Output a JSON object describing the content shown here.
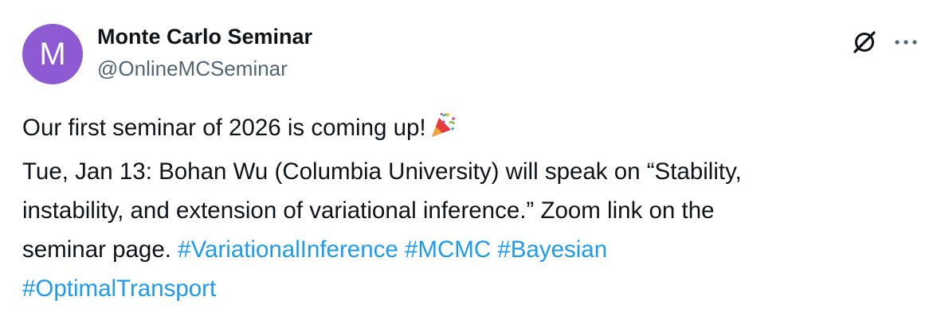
{
  "author": {
    "display_name": "Monte Carlo Seminar",
    "handle": "@OnlineMCSeminar",
    "avatar_letter": "M",
    "avatar_color": "#8e5ad4"
  },
  "header_actions": {
    "grok_icon": "grok-icon",
    "more_icon": "more-icon"
  },
  "tweet": {
    "line1": "Our first seminar of 2026 is coming up!",
    "line1_emoji": "party-popper-icon",
    "line2": "Tue, Jan 13: Bohan Wu (Columbia University) will speak on “Stability,",
    "line3": "instability, and extension of variational inference.”  Zoom link on the",
    "line4_text": "seminar page.",
    "hashtags": [
      "#VariationalInference",
      "#MCMC",
      "#Bayesian",
      "#OptimalTransport"
    ]
  },
  "colors": {
    "text": "#0f1419",
    "secondary": "#536471",
    "link": "#1d9bf0"
  }
}
